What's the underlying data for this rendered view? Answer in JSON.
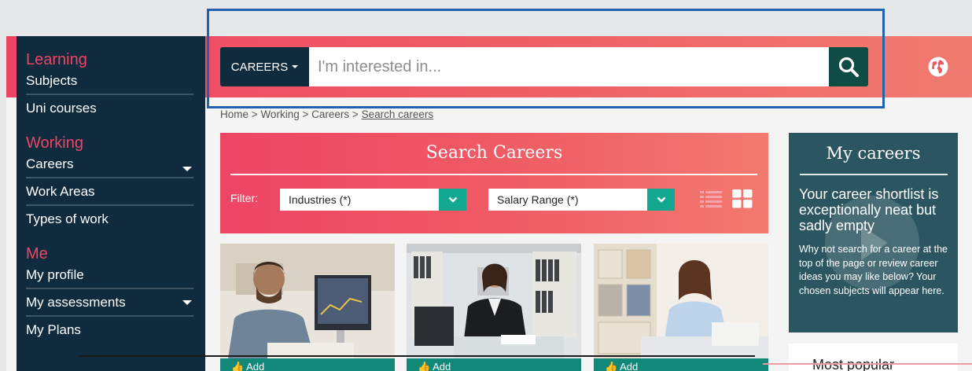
{
  "sidebar": {
    "sections": [
      {
        "heading": "Learning",
        "items": [
          "Subjects",
          "Uni courses"
        ]
      },
      {
        "heading": "Working",
        "items": [
          "Careers",
          "Work Areas",
          "Types of work"
        ]
      },
      {
        "heading": "Me",
        "items": [
          "My profile",
          "My assessments",
          "My Plans"
        ]
      }
    ]
  },
  "search": {
    "category_label": "CAREERS",
    "placeholder": "I'm interested in..."
  },
  "breadcrumb": {
    "home": "Home",
    "working": "Working",
    "careers": "Careers",
    "current": "Search careers",
    "separator": ">"
  },
  "search_careers": {
    "title": "Search Careers",
    "filter_label": "Filter:",
    "industries_select": "Industries (*)",
    "salary_select": "Salary Range (*)"
  },
  "cards": [
    {
      "add_label": "Add"
    },
    {
      "add_label": "Add"
    },
    {
      "add_label": "Add"
    }
  ],
  "my_careers": {
    "title": "My careers",
    "headline": "Your career shortlist is exceptionally neat but sadly empty",
    "body": "Why not search for a career at the top of the page or review career ideas you may like below? Your chosen subjects will appear here."
  },
  "most_popular": {
    "label": "Most popular"
  },
  "colors": {
    "accent": "#ee4565",
    "navy": "#0f2b3d",
    "teal": "#12a88f",
    "dark_teal": "#2b5661",
    "highlight": "#1f62b0"
  }
}
